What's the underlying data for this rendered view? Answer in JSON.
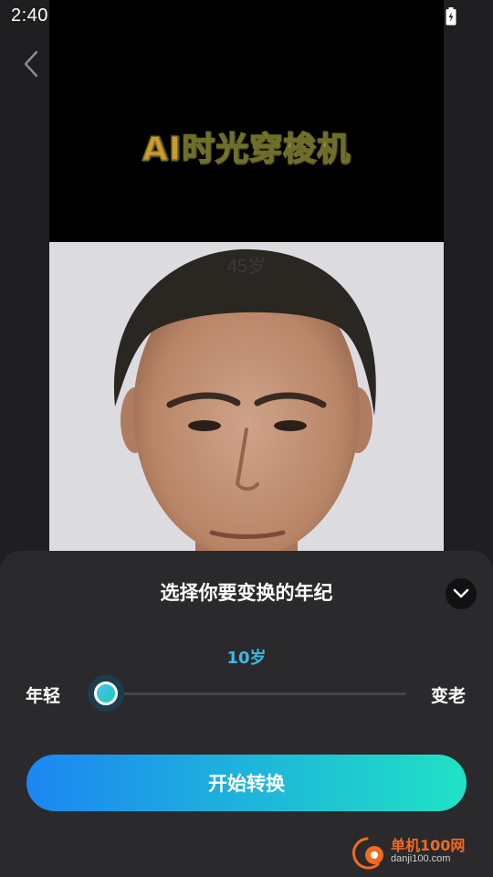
{
  "status_bar": {
    "time": "2:40"
  },
  "preview": {
    "title": "AI时光穿梭机",
    "photo_age_label": "45岁"
  },
  "sheet": {
    "title": "选择你要变换的年纪",
    "slider": {
      "value_label": "10岁",
      "min_label": "年轻",
      "max_label": "变老",
      "position": 0
    },
    "start_button": "开始转换"
  },
  "watermark": {
    "text": "单机100网",
    "url": "danji100.com"
  },
  "icons": {
    "back": "chevron-left-icon",
    "collapse": "chevron-down-icon",
    "wifi": "wifi-icon",
    "signal": "signal-icon",
    "battery": "battery-icon"
  },
  "colors": {
    "accent": "#3bb8e6",
    "button_gradient_start": "#1c86f2",
    "button_gradient_end": "#20e2c4",
    "sheet_bg": "#2a2a2c",
    "title_gold": "#d29a2a"
  }
}
